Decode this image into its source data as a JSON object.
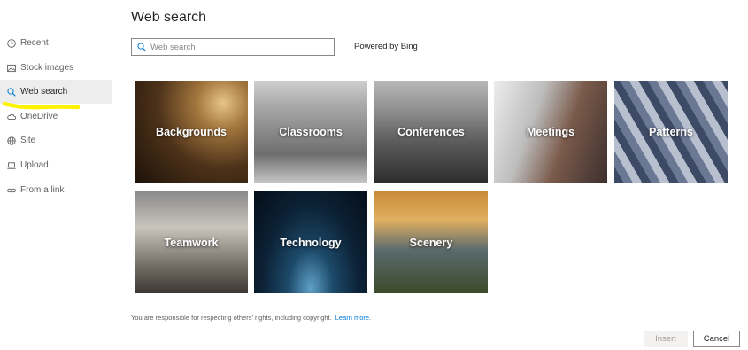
{
  "sidebar": {
    "items": [
      {
        "label": "Recent",
        "icon": "clock-icon",
        "active": false
      },
      {
        "label": "Stock images",
        "icon": "image-icon",
        "active": false
      },
      {
        "label": "Web search",
        "icon": "search-icon",
        "active": true
      },
      {
        "label": "OneDrive",
        "icon": "cloud-icon",
        "active": false
      },
      {
        "label": "Site",
        "icon": "globe-icon",
        "active": false
      },
      {
        "label": "Upload",
        "icon": "laptop-icon",
        "active": false
      },
      {
        "label": "From a link",
        "icon": "link-icon",
        "active": false
      }
    ],
    "highlight_color": "#fff200"
  },
  "main": {
    "title": "Web search",
    "search": {
      "placeholder": "Web search",
      "value": ""
    },
    "powered_by": "Powered by Bing",
    "categories": [
      {
        "label": "Backgrounds"
      },
      {
        "label": "Classrooms"
      },
      {
        "label": "Conferences"
      },
      {
        "label": "Meetings"
      },
      {
        "label": "Patterns"
      },
      {
        "label": "Teamwork"
      },
      {
        "label": "Technology"
      },
      {
        "label": "Scenery"
      }
    ],
    "notice": "You are responsible for respecting others' rights, including copyright.",
    "learn_more": "Learn more."
  },
  "footer": {
    "insert_label": "Insert",
    "cancel_label": "Cancel"
  },
  "colors": {
    "accent": "#0078d4",
    "active_nav_bg": "#ededed"
  }
}
